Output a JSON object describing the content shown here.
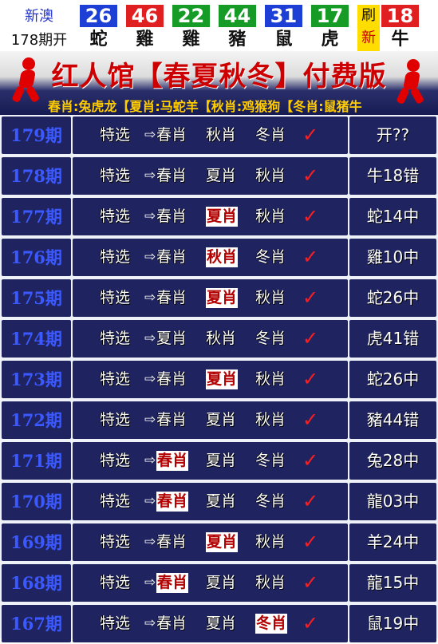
{
  "top": {
    "region": "新澳",
    "open_label": "178期开",
    "balls": [
      {
        "num": "26",
        "zodiac": "蛇",
        "color": "#1d3fd6"
      },
      {
        "num": "46",
        "zodiac": "雞",
        "color": "#e02020"
      },
      {
        "num": "22",
        "zodiac": "雞",
        "color": "#169b26"
      },
      {
        "num": "44",
        "zodiac": "豬",
        "color": "#169b26"
      },
      {
        "num": "31",
        "zodiac": "鼠",
        "color": "#1d3fd6"
      },
      {
        "num": "17",
        "zodiac": "虎",
        "color": "#169b26"
      }
    ],
    "refresh_top": "刷",
    "refresh_bottom": "新",
    "special": {
      "num": "18",
      "zodiac": "牛",
      "color": "#e02020"
    }
  },
  "banner": {
    "title": "红人馆【春夏秋冬】付费版",
    "subtitle": "春肖:兔虎龙【夏肖:马蛇羊【秋肖:鸡猴狗【冬肖:鼠猪牛"
  },
  "table": {
    "label": "特选",
    "arrow": "⇨",
    "check": "✓",
    "rows": [
      {
        "period": "179期",
        "seasons": [
          "春肖",
          "秋肖",
          "冬肖"
        ],
        "hit": -1,
        "result": "开??"
      },
      {
        "period": "178期",
        "seasons": [
          "春肖",
          "夏肖",
          "秋肖"
        ],
        "hit": -1,
        "result": "牛18错"
      },
      {
        "period": "177期",
        "seasons": [
          "春肖",
          "夏肖",
          "秋肖"
        ],
        "hit": 1,
        "result": "蛇14中"
      },
      {
        "period": "176期",
        "seasons": [
          "春肖",
          "秋肖",
          "冬肖"
        ],
        "hit": 1,
        "result": "雞10中"
      },
      {
        "period": "175期",
        "seasons": [
          "春肖",
          "夏肖",
          "秋肖"
        ],
        "hit": 1,
        "result": "蛇26中"
      },
      {
        "period": "174期",
        "seasons": [
          "夏肖",
          "秋肖",
          "冬肖"
        ],
        "hit": -1,
        "result": "虎41错"
      },
      {
        "period": "173期",
        "seasons": [
          "春肖",
          "夏肖",
          "秋肖"
        ],
        "hit": 1,
        "result": "蛇26中"
      },
      {
        "period": "172期",
        "seasons": [
          "春肖",
          "夏肖",
          "秋肖"
        ],
        "hit": -1,
        "result": "豬44错"
      },
      {
        "period": "171期",
        "seasons": [
          "春肖",
          "夏肖",
          "冬肖"
        ],
        "hit": 0,
        "result": "兔28中"
      },
      {
        "period": "170期",
        "seasons": [
          "春肖",
          "夏肖",
          "冬肖"
        ],
        "hit": 0,
        "result": "龍03中"
      },
      {
        "period": "169期",
        "seasons": [
          "春肖",
          "夏肖",
          "秋肖"
        ],
        "hit": 1,
        "result": "羊24中"
      },
      {
        "period": "168期",
        "seasons": [
          "春肖",
          "夏肖",
          "秋肖"
        ],
        "hit": 0,
        "result": "龍15中"
      },
      {
        "period": "167期",
        "seasons": [
          "春肖",
          "夏肖",
          "冬肖"
        ],
        "hit": 2,
        "result": "鼠19中"
      }
    ]
  }
}
